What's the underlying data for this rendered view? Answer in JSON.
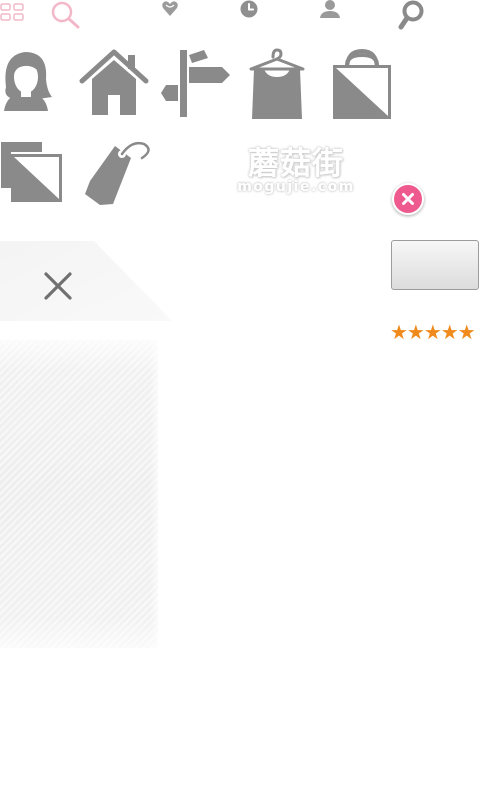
{
  "toolbar": {
    "icons": [
      "grid-icon",
      "search-icon",
      "heart-icon",
      "clock-icon",
      "user-icon",
      "magnifier-icon"
    ]
  },
  "icon_grid": {
    "items": [
      "woman-avatar-icon",
      "home-icon",
      "signpost-icon",
      "dress-hanger-icon",
      "shopping-bag-icon",
      "catalog-icon",
      "price-tag-icon"
    ]
  },
  "watermark": {
    "brand_cn": "蘑菇街",
    "brand_en": "mogujie.com"
  },
  "rating": {
    "stars_text": "★★★★★",
    "value": 5,
    "max": 5
  },
  "colors": {
    "icon_gray": "#8a8a8a",
    "pink": "#ee5a8d",
    "star_orange": "#f08a1c"
  }
}
